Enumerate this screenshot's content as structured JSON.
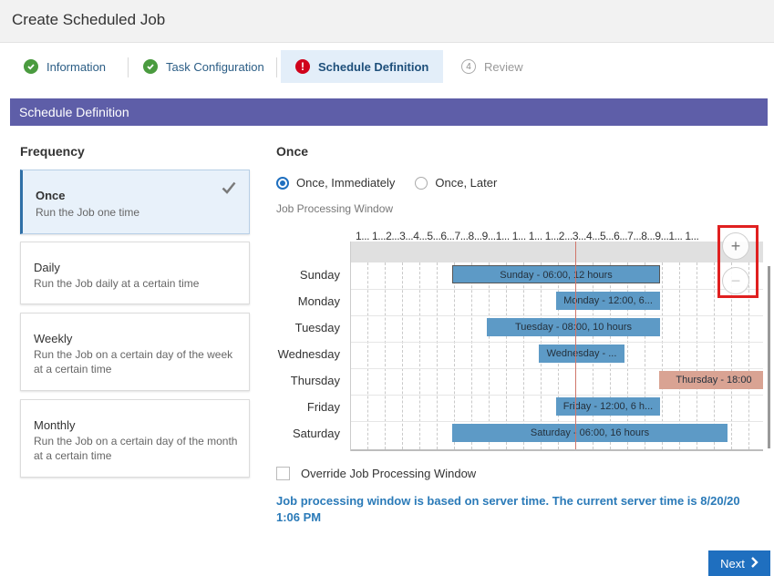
{
  "window": {
    "title": "Create Scheduled Job"
  },
  "steps": [
    {
      "label": "Information",
      "state": "complete"
    },
    {
      "label": "Task Configuration",
      "state": "complete"
    },
    {
      "label": "Schedule Definition",
      "state": "active",
      "icon_text": "!"
    },
    {
      "label": "Review",
      "state": "pending",
      "number": "4"
    }
  ],
  "section": {
    "title": "Schedule Definition"
  },
  "frequency": {
    "title": "Frequency",
    "options": [
      {
        "name": "Once",
        "desc": "Run the Job one time",
        "selected": true
      },
      {
        "name": "Daily",
        "desc": "Run the Job daily at a certain time",
        "selected": false
      },
      {
        "name": "Weekly",
        "desc": "Run the Job on a certain day of the week at a certain time",
        "selected": false
      },
      {
        "name": "Monthly",
        "desc": "Run the Job on a certain day of the month at a certain time",
        "selected": false
      }
    ]
  },
  "once": {
    "title": "Once",
    "radio_immediately": "Once, Immediately",
    "radio_later": "Once, Later",
    "selected": "Once, Immediately"
  },
  "window_label": "Job Processing Window",
  "hour_header": "1... 1...2...3...4...5...6...7...8...9...1... 1... 1... 1...2...3...4...5...6...7...8...9...1... 1...",
  "days": [
    {
      "day": "Sunday",
      "bar": "Sunday - 06:00, 12 hours"
    },
    {
      "day": "Monday",
      "bar": "Monday - 12:00, 6..."
    },
    {
      "day": "Tuesday",
      "bar": "Tuesday - 08:00, 10 hours"
    },
    {
      "day": "Wednesday",
      "bar": "Wednesday - ..."
    },
    {
      "day": "Thursday",
      "bar": "Thursday - 18:00"
    },
    {
      "day": "Friday",
      "bar": "Friday - 12:00, 6 h..."
    },
    {
      "day": "Saturday",
      "bar": "Saturday - 06:00, 16 hours"
    }
  ],
  "zoom": {
    "in": "+",
    "out": "−"
  },
  "override_label": "Override Job Processing Window",
  "note": "Job processing window is based on server time. The current server time is 8/20/20 1:06 PM",
  "next_label": "Next",
  "colors": {
    "accent": "#1f6fbf",
    "section_header": "#5e5ea8",
    "bar": "#5d9ac6",
    "bar_thursday": "#d9a393",
    "highlight_box": "#e02020"
  }
}
